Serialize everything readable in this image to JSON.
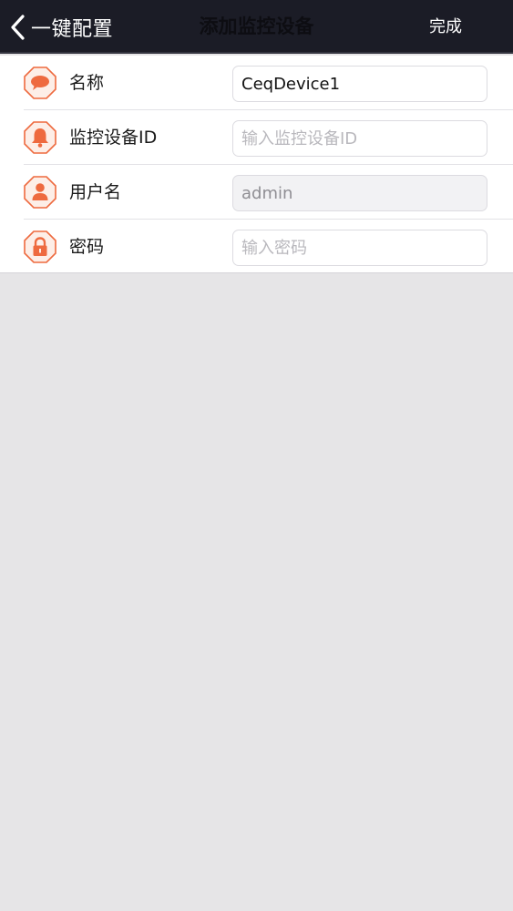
{
  "nav": {
    "back_label": "一键配置",
    "title": "添加监控设备",
    "done_label": "完成"
  },
  "form": {
    "rows": [
      {
        "label": "名称",
        "value": "CeqDevice1",
        "placeholder": "",
        "icon": "speech-bubble-icon"
      },
      {
        "label": "监控设备ID",
        "value": "",
        "placeholder": "输入监控设备ID",
        "icon": "bell-icon"
      },
      {
        "label": "用户名",
        "value": "admin",
        "placeholder": "",
        "icon": "user-icon"
      },
      {
        "label": "密码",
        "value": "",
        "placeholder": "输入密码",
        "icon": "lock-icon"
      }
    ]
  },
  "colors": {
    "navbar_bg": "#1b1c26",
    "icon_accent": "#ee6a3f",
    "page_bg": "#e6e5e7"
  }
}
